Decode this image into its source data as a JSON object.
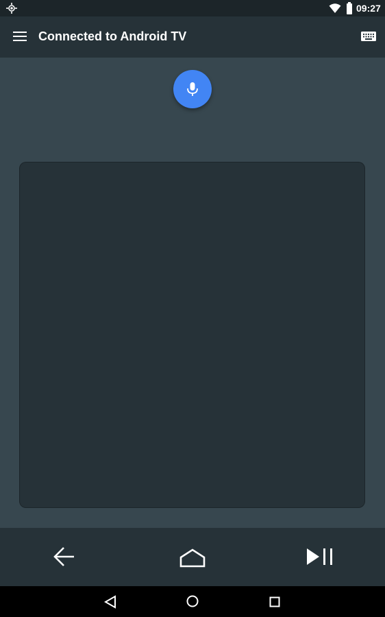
{
  "status_bar": {
    "time": "09:27",
    "icons": [
      "gps-icon",
      "wifi-icon",
      "battery-icon"
    ]
  },
  "app_bar": {
    "title": "Connected to Android TV",
    "menu_icon": "menu-icon",
    "keyboard_icon": "keyboard-icon"
  },
  "main": {
    "mic_icon": "mic-icon",
    "accent_color": "#4285f4"
  },
  "controls": {
    "icons": [
      "back-arrow-icon",
      "home-icon",
      "play-pause-icon"
    ]
  },
  "nav_bar": {
    "icons": [
      "nav-back-icon",
      "nav-home-icon",
      "nav-recents-icon"
    ]
  }
}
